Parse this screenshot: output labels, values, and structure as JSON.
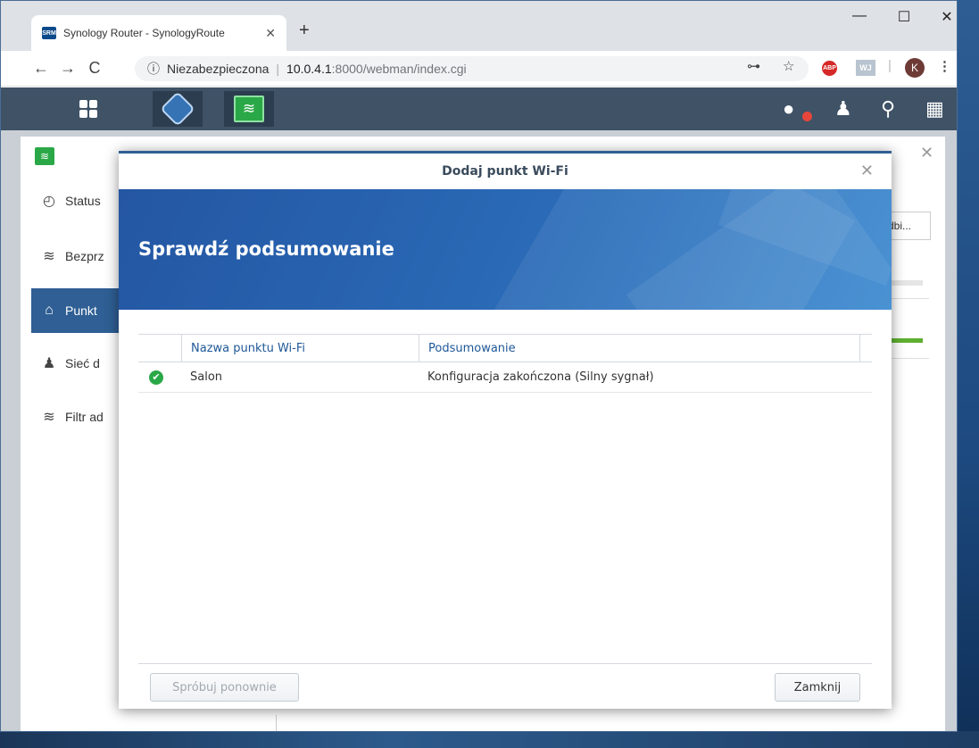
{
  "browser": {
    "tab_title": "Synology Router - SynologyRoute",
    "favicon_text": "SRM",
    "new_tab": "+",
    "tab_close": "✕",
    "window_controls": {
      "minimize": "—",
      "maximize": "☐",
      "close": "✕"
    },
    "nav": {
      "back": "←",
      "forward": "→",
      "reload": "C"
    },
    "address": {
      "info_icon": "ⓘ",
      "security": "Niezabezpieczona",
      "separator": "|",
      "host": "10.0.4.1",
      "path": ":8000/webman/index.cgi"
    },
    "extensions": {
      "key": "⊶",
      "star": "☆",
      "abp": "ABP",
      "wj": "WJ",
      "divider": "|",
      "avatar": "K",
      "menu": "⋮"
    }
  },
  "srm": {
    "app_close": "✕",
    "sidebar": [
      {
        "label": "Status",
        "icon": "gauge-icon",
        "glyph": "◴"
      },
      {
        "label": "Bezprz",
        "icon": "wifi-icon",
        "glyph": "≋"
      },
      {
        "label": "Punkt",
        "icon": "wifi-point-icon",
        "glyph": "⌂"
      },
      {
        "label": "Sieć d",
        "icon": "users-icon",
        "glyph": "♟"
      },
      {
        "label": "Filtr ad",
        "icon": "filter-icon",
        "glyph": "≋"
      }
    ],
    "right_peek_tab": "dbi..."
  },
  "modal": {
    "title": "Dodaj punkt Wi-Fi",
    "close": "✕",
    "banner_title": "Sprawdź podsumowanie",
    "table": {
      "headers": [
        "Nazwa punktu Wi-Fi",
        "Podsumowanie"
      ],
      "rows": [
        {
          "status_icon": "✔",
          "name": "Salon",
          "summary": "Konfiguracja zakończona (Silny sygnał)"
        }
      ]
    },
    "buttons": {
      "retry": "Spróbuj ponownie",
      "close": "Zamknij"
    }
  },
  "colors": {
    "accent": "#2f5f94",
    "success": "#2aa847",
    "banner": "#2a6bb7"
  }
}
